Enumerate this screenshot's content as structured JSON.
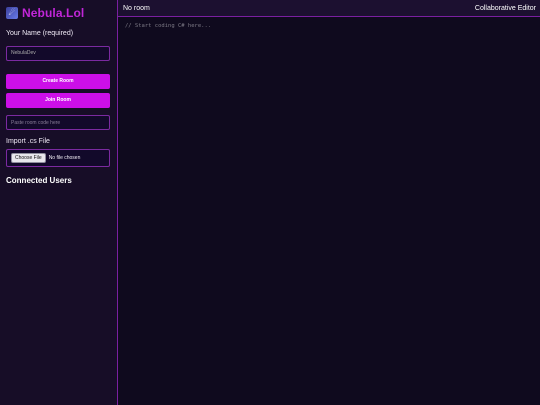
{
  "sidebar": {
    "logo_icon": "rocket-icon",
    "logo_text": "Nebula.Lol",
    "name_label": "Your Name (required)",
    "name_value": "NebulaDev",
    "create_room_label": "Create Room",
    "join_room_label": "Join Room",
    "room_code_placeholder": "Paste room code here",
    "import_label": "Import .cs File",
    "choose_file_label": "Choose File",
    "file_status": "No file chosen",
    "connected_users_title": "Connected Users"
  },
  "topbar": {
    "room_status": "No room",
    "title": "Collaborative Editor"
  },
  "editor": {
    "placeholder": "// Start coding C# here..."
  },
  "colors": {
    "accent": "#cc0fe8",
    "brand": "#c126d8",
    "border": "#7a1fa0",
    "background": "#0f0a1e"
  }
}
